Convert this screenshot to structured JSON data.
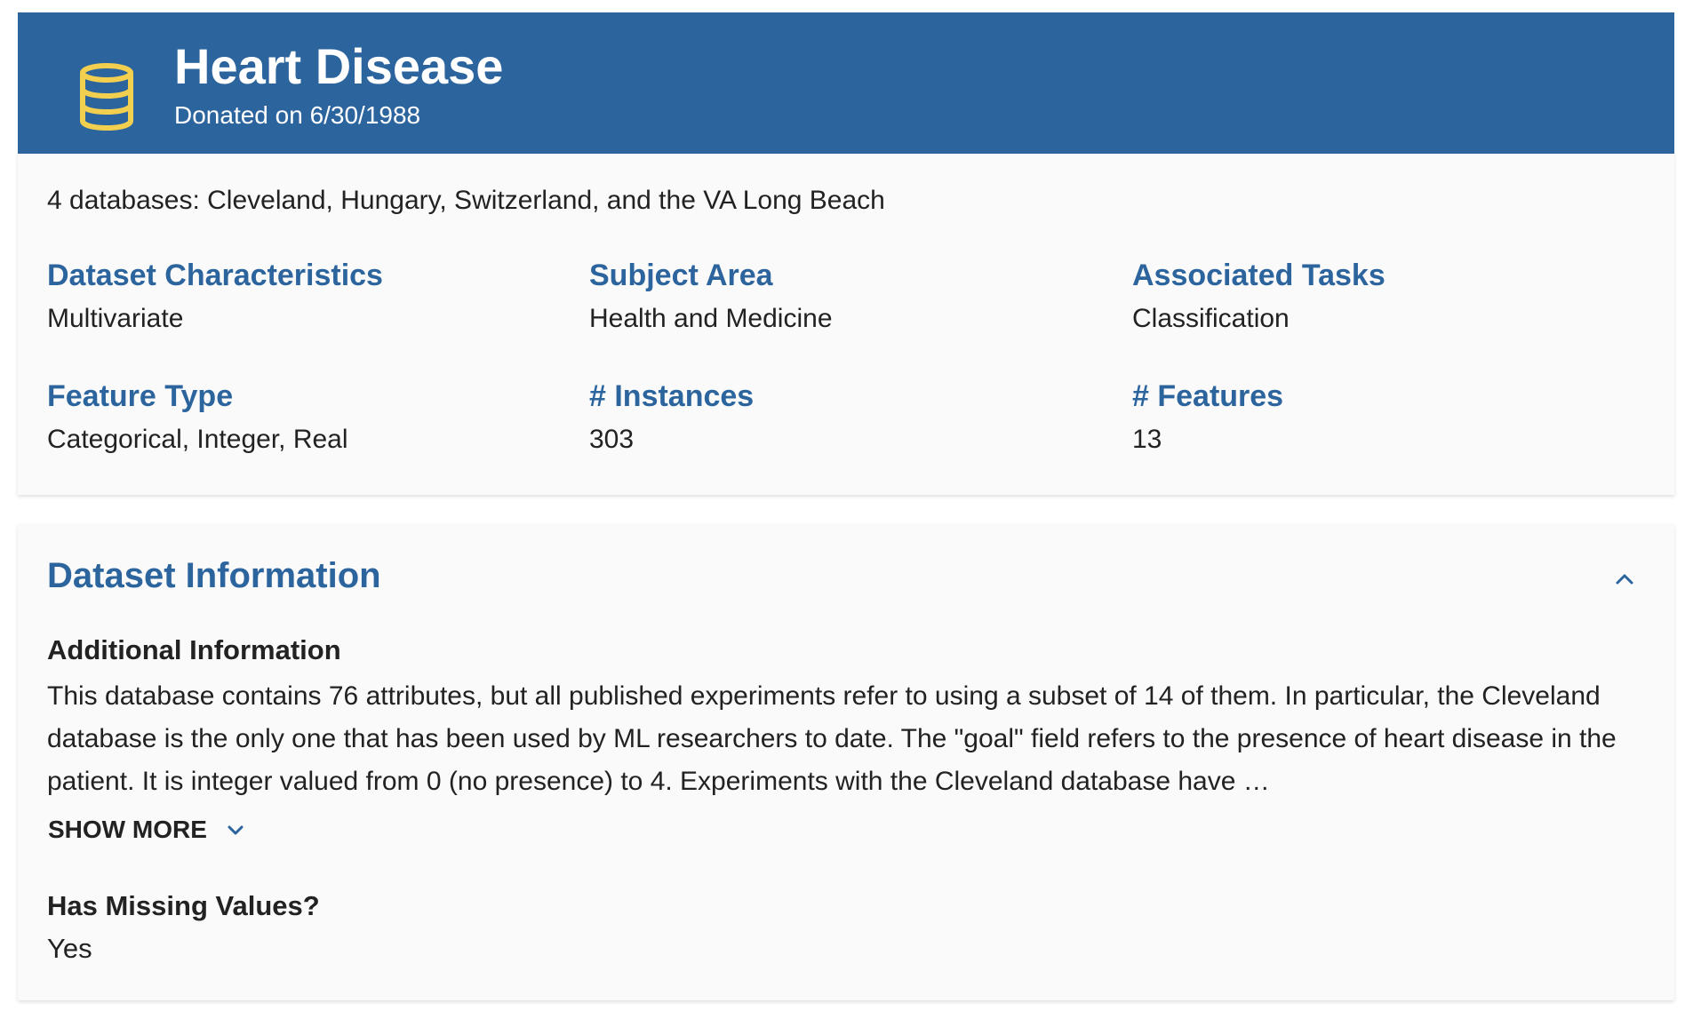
{
  "header": {
    "title": "Heart Disease",
    "subtitle": "Donated on 6/30/1988",
    "icon": "database-icon",
    "background_color": "#2c649e",
    "icon_color": "#f2cf4f"
  },
  "summary": {
    "description": "4 databases: Cleveland, Hungary, Switzerland, and the VA Long Beach",
    "fields": [
      {
        "label": "Dataset Characteristics",
        "value": "Multivariate"
      },
      {
        "label": "Subject Area",
        "value": "Health and Medicine"
      },
      {
        "label": "Associated Tasks",
        "value": "Classification"
      },
      {
        "label": "Feature Type",
        "value": "Categorical, Integer, Real"
      },
      {
        "label": "# Instances",
        "value": "303"
      },
      {
        "label": "# Features",
        "value": "13"
      }
    ]
  },
  "dataset_info": {
    "heading": "Dataset Information",
    "collapse_icon": "chevron-up-icon",
    "additional_info_label": "Additional Information",
    "additional_info_text": "This database contains 76 attributes, but all published experiments refer to using a subset of 14 of them.  In particular, the Cleveland database is the only one that has been used by ML researchers to date.  The \"goal\" field refers to the presence of heart disease in the patient.  It is integer valued from 0 (no presence) to 4. Experiments with the Cleveland database have …",
    "show_more_label": "SHOW MORE",
    "show_more_icon": "chevron-down-icon",
    "missing_values_label": "Has Missing Values?",
    "missing_values_value": "Yes"
  },
  "colors": {
    "accent": "#2c649e",
    "card_background": "#fafafa",
    "text": "#222222"
  }
}
